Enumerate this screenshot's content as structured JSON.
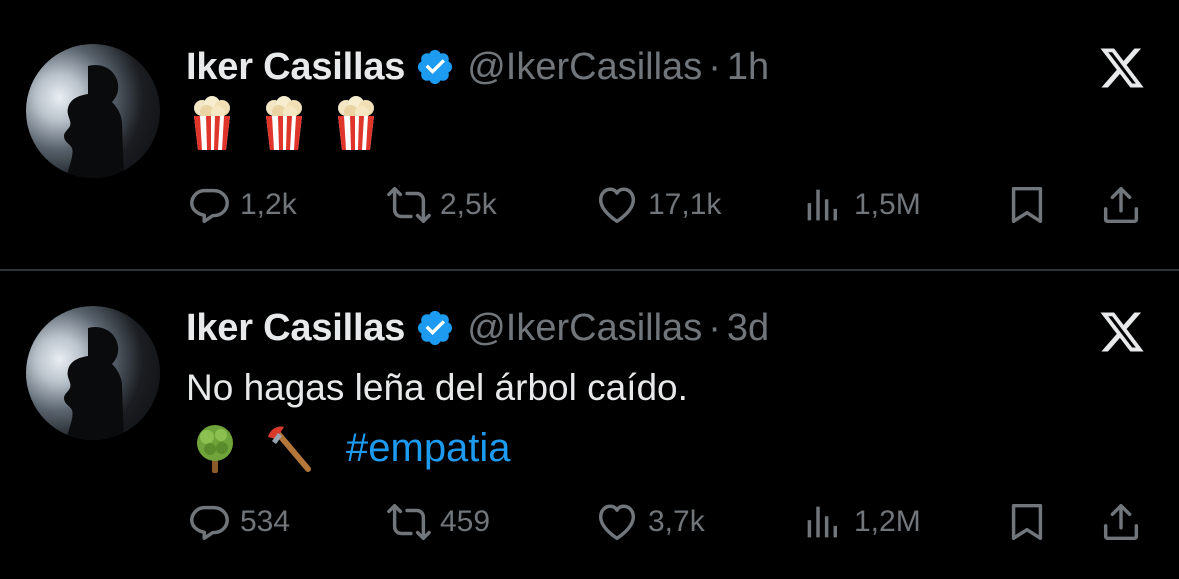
{
  "colors": {
    "background": "#000000",
    "text": "#e7e9ea",
    "muted": "#71767b",
    "link": "#1d9bf0",
    "verified": "#1d9bf0",
    "divider": "#2f3336"
  },
  "tweets": [
    {
      "name": "Iker Casillas",
      "handle": "@IkerCasillas",
      "separator": "·",
      "time": "1h",
      "emojis": [
        "popcorn",
        "popcorn",
        "popcorn"
      ],
      "replies": "1,2k",
      "retweets": "2,5k",
      "likes": "17,1k",
      "views": "1,5M"
    },
    {
      "name": "Iker Casillas",
      "handle": "@IkerCasillas",
      "separator": "·",
      "time": "3d",
      "text": "No hagas leña del árbol caído.",
      "emojis": [
        "deciduous-tree",
        "axe"
      ],
      "hashtag": "#empatia",
      "replies": "534",
      "retweets": "459",
      "likes": "3,7k",
      "views": "1,2M"
    }
  ]
}
